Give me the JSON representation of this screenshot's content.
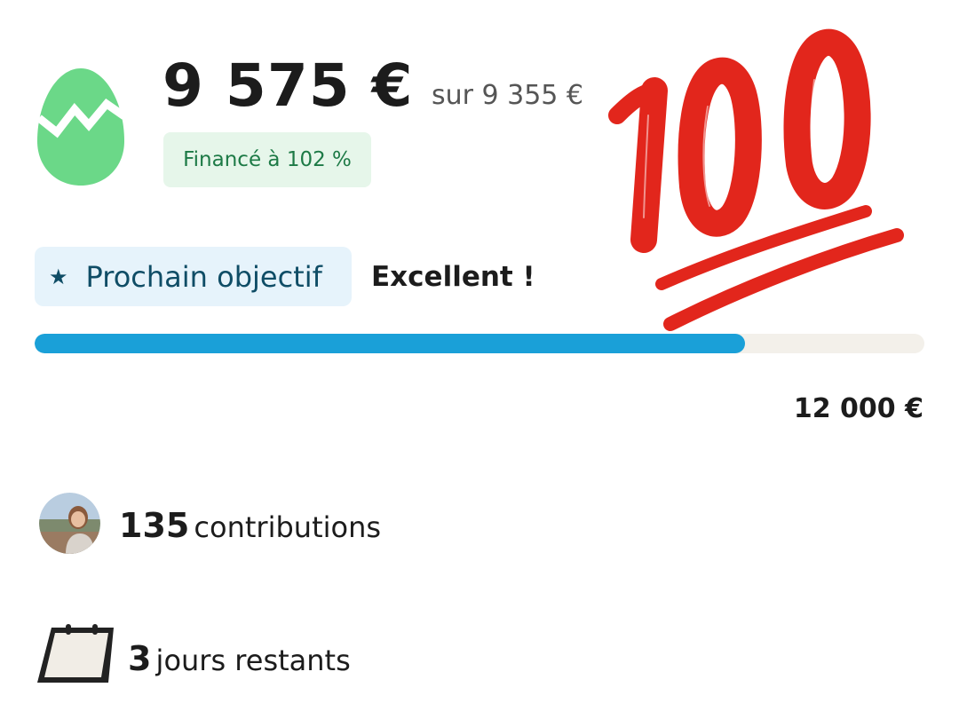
{
  "campaign": {
    "amount_raised": "9 575 €",
    "goal_text": "sur 9 355 €",
    "funded_badge": "Financé à 102 %"
  },
  "next_objective": {
    "label": "Prochain objectif",
    "status": "Excellent !",
    "target": "12 000 €",
    "progress_percent": 79.8
  },
  "contributions": {
    "count": "135",
    "label": "contributions"
  },
  "time_left": {
    "count": "3",
    "label": "jours restants"
  },
  "icons": {
    "egg": "egg-icon",
    "hundred": "hundred-points-emoji",
    "star": "star-icon",
    "calendar": "calendar-icon"
  },
  "colors": {
    "egg_green": "#6bd888",
    "progress_blue": "#1aa0d8",
    "emoji_red": "#e2261c",
    "badge_green_bg": "#e6f6ea",
    "badge_green_text": "#1d7a46",
    "objective_bg": "#e6f3fb",
    "objective_text": "#0f4d66"
  }
}
